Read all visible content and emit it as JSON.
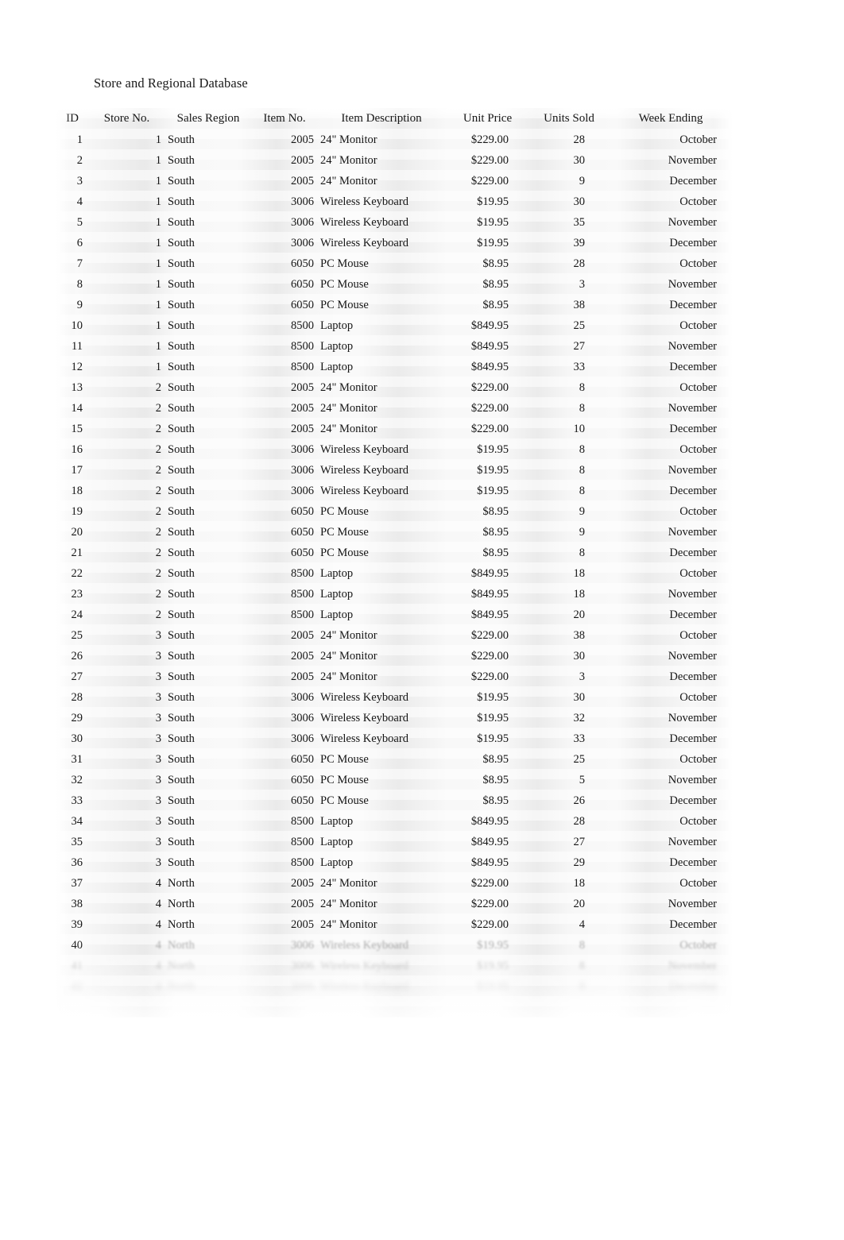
{
  "document": {
    "title": "Store and Regional Database"
  },
  "table": {
    "columns": [
      {
        "key": "id",
        "label": "ID",
        "align": "right"
      },
      {
        "key": "store_no",
        "label": "Store No.",
        "align": "right"
      },
      {
        "key": "sales_region",
        "label": "Sales Region",
        "align": "left"
      },
      {
        "key": "item_no",
        "label": "Item No.",
        "align": "right"
      },
      {
        "key": "item_desc",
        "label": "Item Description",
        "align": "left"
      },
      {
        "key": "unit_price",
        "label": "Unit Price",
        "align": "right"
      },
      {
        "key": "units_sold",
        "label": "Units Sold",
        "align": "right"
      },
      {
        "key": "week_ending",
        "label": "Week Ending",
        "align": "right"
      }
    ],
    "rows": [
      {
        "id": "1",
        "store_no": "1",
        "sales_region": "South",
        "item_no": "2005",
        "item_desc": "24\" Monitor",
        "unit_price": "$229.00",
        "units_sold": "28",
        "week_ending": "October"
      },
      {
        "id": "2",
        "store_no": "1",
        "sales_region": "South",
        "item_no": "2005",
        "item_desc": "24\" Monitor",
        "unit_price": "$229.00",
        "units_sold": "30",
        "week_ending": "November"
      },
      {
        "id": "3",
        "store_no": "1",
        "sales_region": "South",
        "item_no": "2005",
        "item_desc": "24\" Monitor",
        "unit_price": "$229.00",
        "units_sold": "9",
        "week_ending": "December"
      },
      {
        "id": "4",
        "store_no": "1",
        "sales_region": "South",
        "item_no": "3006",
        "item_desc": "Wireless Keyboard",
        "unit_price": "$19.95",
        "units_sold": "30",
        "week_ending": "October"
      },
      {
        "id": "5",
        "store_no": "1",
        "sales_region": "South",
        "item_no": "3006",
        "item_desc": "Wireless Keyboard",
        "unit_price": "$19.95",
        "units_sold": "35",
        "week_ending": "November"
      },
      {
        "id": "6",
        "store_no": "1",
        "sales_region": "South",
        "item_no": "3006",
        "item_desc": "Wireless Keyboard",
        "unit_price": "$19.95",
        "units_sold": "39",
        "week_ending": "December"
      },
      {
        "id": "7",
        "store_no": "1",
        "sales_region": "South",
        "item_no": "6050",
        "item_desc": "PC Mouse",
        "unit_price": "$8.95",
        "units_sold": "28",
        "week_ending": "October"
      },
      {
        "id": "8",
        "store_no": "1",
        "sales_region": "South",
        "item_no": "6050",
        "item_desc": "PC Mouse",
        "unit_price": "$8.95",
        "units_sold": "3",
        "week_ending": "November"
      },
      {
        "id": "9",
        "store_no": "1",
        "sales_region": "South",
        "item_no": "6050",
        "item_desc": "PC Mouse",
        "unit_price": "$8.95",
        "units_sold": "38",
        "week_ending": "December"
      },
      {
        "id": "10",
        "store_no": "1",
        "sales_region": "South",
        "item_no": "8500",
        "item_desc": "Laptop",
        "unit_price": "$849.95",
        "units_sold": "25",
        "week_ending": "October"
      },
      {
        "id": "11",
        "store_no": "1",
        "sales_region": "South",
        "item_no": "8500",
        "item_desc": "Laptop",
        "unit_price": "$849.95",
        "units_sold": "27",
        "week_ending": "November"
      },
      {
        "id": "12",
        "store_no": "1",
        "sales_region": "South",
        "item_no": "8500",
        "item_desc": "Laptop",
        "unit_price": "$849.95",
        "units_sold": "33",
        "week_ending": "December"
      },
      {
        "id": "13",
        "store_no": "2",
        "sales_region": "South",
        "item_no": "2005",
        "item_desc": "24\" Monitor",
        "unit_price": "$229.00",
        "units_sold": "8",
        "week_ending": "October"
      },
      {
        "id": "14",
        "store_no": "2",
        "sales_region": "South",
        "item_no": "2005",
        "item_desc": "24\" Monitor",
        "unit_price": "$229.00",
        "units_sold": "8",
        "week_ending": "November"
      },
      {
        "id": "15",
        "store_no": "2",
        "sales_region": "South",
        "item_no": "2005",
        "item_desc": "24\" Monitor",
        "unit_price": "$229.00",
        "units_sold": "10",
        "week_ending": "December"
      },
      {
        "id": "16",
        "store_no": "2",
        "sales_region": "South",
        "item_no": "3006",
        "item_desc": "Wireless Keyboard",
        "unit_price": "$19.95",
        "units_sold": "8",
        "week_ending": "October"
      },
      {
        "id": "17",
        "store_no": "2",
        "sales_region": "South",
        "item_no": "3006",
        "item_desc": "Wireless Keyboard",
        "unit_price": "$19.95",
        "units_sold": "8",
        "week_ending": "November"
      },
      {
        "id": "18",
        "store_no": "2",
        "sales_region": "South",
        "item_no": "3006",
        "item_desc": "Wireless Keyboard",
        "unit_price": "$19.95",
        "units_sold": "8",
        "week_ending": "December"
      },
      {
        "id": "19",
        "store_no": "2",
        "sales_region": "South",
        "item_no": "6050",
        "item_desc": "PC Mouse",
        "unit_price": "$8.95",
        "units_sold": "9",
        "week_ending": "October"
      },
      {
        "id": "20",
        "store_no": "2",
        "sales_region": "South",
        "item_no": "6050",
        "item_desc": "PC Mouse",
        "unit_price": "$8.95",
        "units_sold": "9",
        "week_ending": "November"
      },
      {
        "id": "21",
        "store_no": "2",
        "sales_region": "South",
        "item_no": "6050",
        "item_desc": "PC Mouse",
        "unit_price": "$8.95",
        "units_sold": "8",
        "week_ending": "December"
      },
      {
        "id": "22",
        "store_no": "2",
        "sales_region": "South",
        "item_no": "8500",
        "item_desc": "Laptop",
        "unit_price": "$849.95",
        "units_sold": "18",
        "week_ending": "October"
      },
      {
        "id": "23",
        "store_no": "2",
        "sales_region": "South",
        "item_no": "8500",
        "item_desc": "Laptop",
        "unit_price": "$849.95",
        "units_sold": "18",
        "week_ending": "November"
      },
      {
        "id": "24",
        "store_no": "2",
        "sales_region": "South",
        "item_no": "8500",
        "item_desc": "Laptop",
        "unit_price": "$849.95",
        "units_sold": "20",
        "week_ending": "December"
      },
      {
        "id": "25",
        "store_no": "3",
        "sales_region": "South",
        "item_no": "2005",
        "item_desc": "24\" Monitor",
        "unit_price": "$229.00",
        "units_sold": "38",
        "week_ending": "October"
      },
      {
        "id": "26",
        "store_no": "3",
        "sales_region": "South",
        "item_no": "2005",
        "item_desc": "24\" Monitor",
        "unit_price": "$229.00",
        "units_sold": "30",
        "week_ending": "November"
      },
      {
        "id": "27",
        "store_no": "3",
        "sales_region": "South",
        "item_no": "2005",
        "item_desc": "24\" Monitor",
        "unit_price": "$229.00",
        "units_sold": "3",
        "week_ending": "December"
      },
      {
        "id": "28",
        "store_no": "3",
        "sales_region": "South",
        "item_no": "3006",
        "item_desc": "Wireless Keyboard",
        "unit_price": "$19.95",
        "units_sold": "30",
        "week_ending": "October"
      },
      {
        "id": "29",
        "store_no": "3",
        "sales_region": "South",
        "item_no": "3006",
        "item_desc": "Wireless Keyboard",
        "unit_price": "$19.95",
        "units_sold": "32",
        "week_ending": "November"
      },
      {
        "id": "30",
        "store_no": "3",
        "sales_region": "South",
        "item_no": "3006",
        "item_desc": "Wireless Keyboard",
        "unit_price": "$19.95",
        "units_sold": "33",
        "week_ending": "December"
      },
      {
        "id": "31",
        "store_no": "3",
        "sales_region": "South",
        "item_no": "6050",
        "item_desc": "PC Mouse",
        "unit_price": "$8.95",
        "units_sold": "25",
        "week_ending": "October"
      },
      {
        "id": "32",
        "store_no": "3",
        "sales_region": "South",
        "item_no": "6050",
        "item_desc": "PC Mouse",
        "unit_price": "$8.95",
        "units_sold": "5",
        "week_ending": "November"
      },
      {
        "id": "33",
        "store_no": "3",
        "sales_region": "South",
        "item_no": "6050",
        "item_desc": "PC Mouse",
        "unit_price": "$8.95",
        "units_sold": "26",
        "week_ending": "December"
      },
      {
        "id": "34",
        "store_no": "3",
        "sales_region": "South",
        "item_no": "8500",
        "item_desc": "Laptop",
        "unit_price": "$849.95",
        "units_sold": "28",
        "week_ending": "October"
      },
      {
        "id": "35",
        "store_no": "3",
        "sales_region": "South",
        "item_no": "8500",
        "item_desc": "Laptop",
        "unit_price": "$849.95",
        "units_sold": "27",
        "week_ending": "November"
      },
      {
        "id": "36",
        "store_no": "3",
        "sales_region": "South",
        "item_no": "8500",
        "item_desc": "Laptop",
        "unit_price": "$849.95",
        "units_sold": "29",
        "week_ending": "December"
      },
      {
        "id": "37",
        "store_no": "4",
        "sales_region": "North",
        "item_no": "2005",
        "item_desc": "24\" Monitor",
        "unit_price": "$229.00",
        "units_sold": "18",
        "week_ending": "October"
      },
      {
        "id": "38",
        "store_no": "4",
        "sales_region": "North",
        "item_no": "2005",
        "item_desc": "24\" Monitor",
        "unit_price": "$229.00",
        "units_sold": "20",
        "week_ending": "November"
      },
      {
        "id": "39",
        "store_no": "4",
        "sales_region": "North",
        "item_no": "2005",
        "item_desc": "24\" Monitor",
        "unit_price": "$229.00",
        "units_sold": "4",
        "week_ending": "December"
      },
      {
        "id": "40",
        "store_no": "4",
        "sales_region": "North",
        "item_no": "3006",
        "item_desc": "Wireless Keyboard",
        "unit_price": "$19.95",
        "units_sold": "8",
        "week_ending": "October"
      },
      {
        "id": "41",
        "store_no": "4",
        "sales_region": "North",
        "item_no": "3006",
        "item_desc": "Wireless Keyboard",
        "unit_price": "$19.95",
        "units_sold": "8",
        "week_ending": "November"
      },
      {
        "id": "42",
        "store_no": "4",
        "sales_region": "North",
        "item_no": "3006",
        "item_desc": "Wireless Keyboard",
        "unit_price": "$19.95",
        "units_sold": "8",
        "week_ending": "December"
      }
    ],
    "fade_from_row_index": 39
  }
}
